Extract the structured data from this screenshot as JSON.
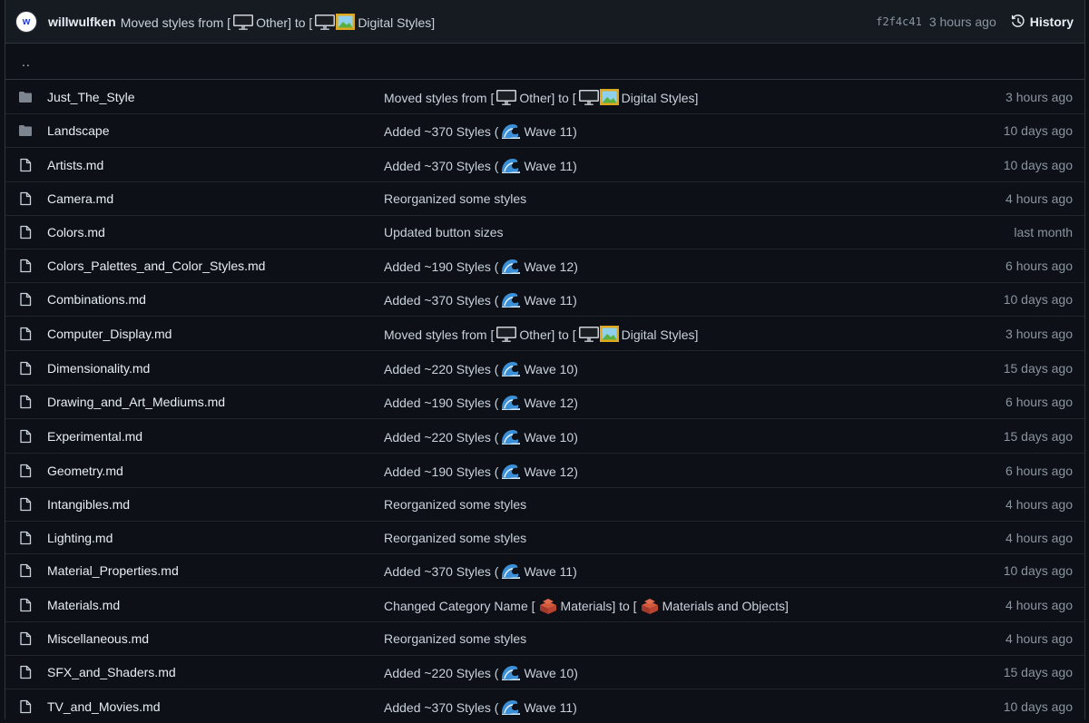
{
  "commit": {
    "author": "willwulfken",
    "message_parts": [
      "Moved styles from [",
      "Other] to [",
      "Digital Styles]"
    ],
    "sha": "f2f4c41",
    "time": "3 hours ago",
    "history_label": "History",
    "avatar_letter": "w"
  },
  "parent_dir": "..",
  "rows": [
    {
      "name": "Just_The_Style",
      "type": "folder",
      "msg": [
        "Moved styles from [",
        "Other] to [",
        "Digital Styles]"
      ],
      "emoji": [
        "monitor",
        "monitor-picture"
      ],
      "age": "3 hours ago"
    },
    {
      "name": "Landscape",
      "type": "folder",
      "msg": [
        "Added ~370 Styles (",
        "Wave 11)"
      ],
      "emoji": [
        "wave"
      ],
      "age": "10 days ago"
    },
    {
      "name": "Artists.md",
      "type": "file",
      "msg": [
        "Added ~370 Styles (",
        "Wave 11)"
      ],
      "emoji": [
        "wave"
      ],
      "age": "10 days ago"
    },
    {
      "name": "Camera.md",
      "type": "file",
      "msg": [
        "Reorganized some styles"
      ],
      "emoji": [],
      "age": "4 hours ago"
    },
    {
      "name": "Colors.md",
      "type": "file",
      "msg": [
        "Updated button sizes"
      ],
      "emoji": [],
      "age": "last month"
    },
    {
      "name": "Colors_Palettes_and_Color_Styles.md",
      "type": "file",
      "msg": [
        "Added ~190 Styles (",
        "Wave 12)"
      ],
      "emoji": [
        "wave"
      ],
      "age": "6 hours ago"
    },
    {
      "name": "Combinations.md",
      "type": "file",
      "msg": [
        "Added ~370 Styles (",
        "Wave 11)"
      ],
      "emoji": [
        "wave"
      ],
      "age": "10 days ago"
    },
    {
      "name": "Computer_Display.md",
      "type": "file",
      "msg": [
        "Moved styles from [",
        "Other] to [",
        "Digital Styles]"
      ],
      "emoji": [
        "monitor",
        "monitor-picture"
      ],
      "age": "3 hours ago"
    },
    {
      "name": "Dimensionality.md",
      "type": "file",
      "msg": [
        "Added ~220 Styles (",
        "Wave 10)"
      ],
      "emoji": [
        "wave"
      ],
      "age": "15 days ago"
    },
    {
      "name": "Drawing_and_Art_Mediums.md",
      "type": "file",
      "msg": [
        "Added ~190 Styles (",
        "Wave 12)"
      ],
      "emoji": [
        "wave"
      ],
      "age": "6 hours ago"
    },
    {
      "name": "Experimental.md",
      "type": "file",
      "msg": [
        "Added ~220 Styles (",
        "Wave 10)"
      ],
      "emoji": [
        "wave"
      ],
      "age": "15 days ago"
    },
    {
      "name": "Geometry.md",
      "type": "file",
      "msg": [
        "Added ~190 Styles (",
        "Wave 12)"
      ],
      "emoji": [
        "wave"
      ],
      "age": "6 hours ago"
    },
    {
      "name": "Intangibles.md",
      "type": "file",
      "msg": [
        "Reorganized some styles"
      ],
      "emoji": [],
      "age": "4 hours ago"
    },
    {
      "name": "Lighting.md",
      "type": "file",
      "msg": [
        "Reorganized some styles"
      ],
      "emoji": [],
      "age": "4 hours ago"
    },
    {
      "name": "Material_Properties.md",
      "type": "file",
      "msg": [
        "Added ~370 Styles (",
        "Wave 11)"
      ],
      "emoji": [
        "wave"
      ],
      "age": "10 days ago"
    },
    {
      "name": "Materials.md",
      "type": "file",
      "msg": [
        "Changed Category Name [",
        "Materials] to [",
        "Materials and Objects]"
      ],
      "emoji": [
        "bricks",
        "bricks"
      ],
      "age": "4 hours ago"
    },
    {
      "name": "Miscellaneous.md",
      "type": "file",
      "msg": [
        "Reorganized some styles"
      ],
      "emoji": [],
      "age": "4 hours ago"
    },
    {
      "name": "SFX_and_Shaders.md",
      "type": "file",
      "msg": [
        "Added ~220 Styles (",
        "Wave 10)"
      ],
      "emoji": [
        "wave"
      ],
      "age": "15 days ago"
    },
    {
      "name": "TV_and_Movies.md",
      "type": "file",
      "msg": [
        "Added ~370 Styles (",
        "Wave 11)"
      ],
      "emoji": [
        "wave"
      ],
      "age": "10 days ago"
    }
  ],
  "colors": {
    "background": "#0d1117",
    "header_bg": "#161b22",
    "text": "#e6edf3",
    "muted": "#8b949e",
    "folder_icon": "#7d8590"
  }
}
